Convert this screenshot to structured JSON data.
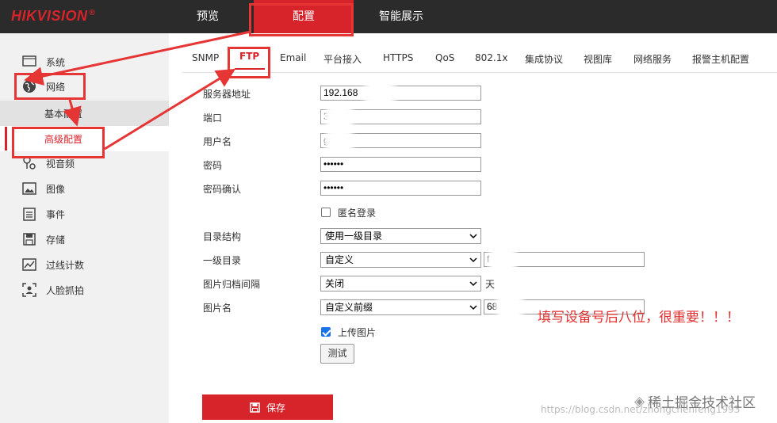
{
  "brand": {
    "logo": "HIKVISION",
    "registered": "®"
  },
  "topnav": {
    "preview": "预览",
    "config": "配置",
    "smart": "智能展示"
  },
  "sidebar": {
    "items": [
      {
        "label": "系统",
        "icon": "monitor-icon"
      },
      {
        "label": "网络",
        "icon": "globe-icon"
      },
      {
        "label": "视音频",
        "icon": "av-icon"
      },
      {
        "label": "图像",
        "icon": "image-icon"
      },
      {
        "label": "事件",
        "icon": "event-icon"
      },
      {
        "label": "存储",
        "icon": "storage-icon"
      },
      {
        "label": "过线计数",
        "icon": "line-count-icon"
      },
      {
        "label": "人脸抓拍",
        "icon": "face-capture-icon"
      }
    ],
    "subitems": {
      "basic": "基本配置",
      "advanced": "高级配置"
    }
  },
  "tabs": [
    "SNMP",
    "FTP",
    "Email",
    "平台接入",
    "HTTPS",
    "QoS",
    "802.1x",
    "集成协议",
    "视图库",
    "网络服务",
    "报警主机配置"
  ],
  "form": {
    "server_label": "服务器地址",
    "server_value": "192.168",
    "port_label": "端口",
    "port_value": "3",
    "username_label": "用户名",
    "username_value": "g      o",
    "password_label": "密码",
    "password_value": "••••••",
    "password_confirm_label": "密码确认",
    "password_confirm_value": "••••••",
    "anonymous_label": "匿名登录",
    "dir_structure_label": "目录结构",
    "dir_structure_value": "使用一级目录",
    "first_dir_label": "一级目录",
    "first_dir_value": "自定义",
    "first_dir_input": "f",
    "archive_interval_label": "图片归档间隔",
    "archive_interval_value": "关闭",
    "archive_unit": "天",
    "picture_name_label": "图片名",
    "picture_name_value": "自定义前缀",
    "picture_name_input": "68      11",
    "upload_label": "上传图片",
    "test_button": "测试",
    "save_button": "保存"
  },
  "annotation": "填写设备号后八位，很重要！！！",
  "watermark": {
    "url": "https://blog.csdn.net/zhongchenfeng1993",
    "site": "稀土掘金技术社区"
  },
  "colors": {
    "accent": "#d7242b",
    "topbar": "#2b2b2b",
    "annotation": "#e03030"
  }
}
